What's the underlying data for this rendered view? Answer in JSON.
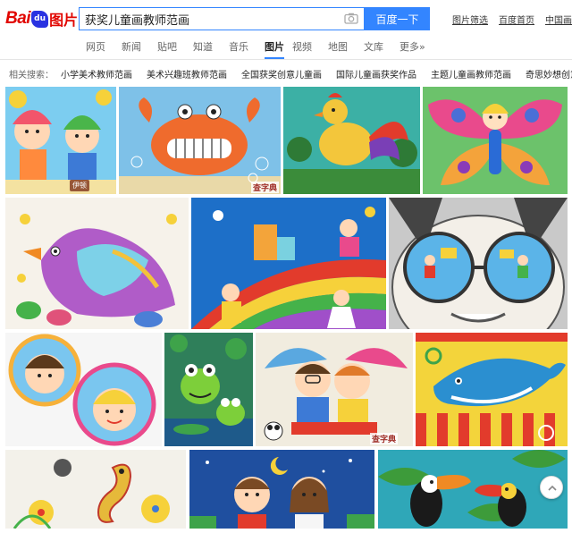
{
  "header": {
    "logo_bai": "Bai",
    "logo_du": "du",
    "logo_img": "图片",
    "search_value": "获奖儿童画教师范画",
    "search_button": "百度一下",
    "links": [
      "图片筛选",
      "百度首页",
      "中国画"
    ]
  },
  "nav": {
    "tabs": [
      {
        "label": "网页",
        "active": false
      },
      {
        "label": "新闻",
        "active": false
      },
      {
        "label": "贴吧",
        "active": false
      },
      {
        "label": "知道",
        "active": false
      },
      {
        "label": "音乐",
        "active": false
      },
      {
        "label": "图片",
        "active": true
      },
      {
        "label": "视频",
        "active": false
      },
      {
        "label": "地图",
        "active": false
      },
      {
        "label": "文库",
        "active": false
      },
      {
        "label": "更多»",
        "active": false
      }
    ]
  },
  "related": {
    "label": "相关搜索：",
    "items": [
      "小学美术教师范画",
      "美术兴趣班教师范画",
      "全国获奖创意儿童画",
      "国际儿童画获奖作品",
      "主题儿童画教师范画",
      "奇思妙想创意儿"
    ]
  },
  "results": {
    "watermarks": [
      "伊顿",
      "查字典",
      "查字典",
      "查字典"
    ]
  },
  "icons": {
    "camera": "camera-icon",
    "search": "search-icon",
    "scroll": "scroll-top-icon"
  },
  "colors": {
    "accent": "#3385ff",
    "brand_red": "#e10601",
    "brand_blue": "#2932e1"
  }
}
